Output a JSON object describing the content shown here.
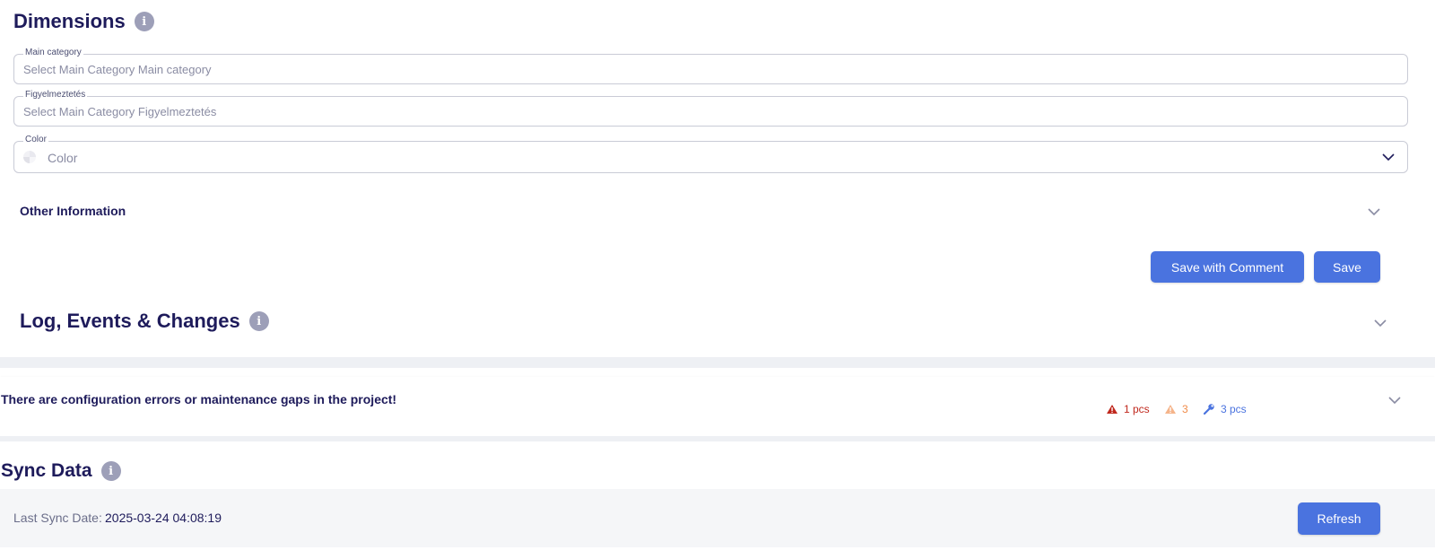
{
  "dimensions": {
    "title": "Dimensions",
    "info_icon": "i",
    "fields": [
      {
        "label": "Main category",
        "placeholder": "Select Main Category Main category"
      },
      {
        "label": "Figyelmeztetés",
        "placeholder": "Select Main Category Figyelmeztetés"
      },
      {
        "label": "Color",
        "placeholder": "Color"
      }
    ],
    "other_information": "Other Information",
    "buttons": {
      "save_with_comment": "Save with Comment",
      "save": "Save"
    }
  },
  "log": {
    "title": "Log, Events & Changes",
    "info_icon": "i"
  },
  "warnings": {
    "message": "There are configuration errors or maintenance gaps in the project!",
    "badges": [
      {
        "icon": "error-triangle-icon",
        "text": "1 pcs",
        "color": "#c0281d"
      },
      {
        "icon": "warning-triangle-icon",
        "text": "3",
        "color": "#f08c4a"
      },
      {
        "icon": "wrench-icon",
        "text": "3 pcs",
        "color": "#4a73df"
      }
    ]
  },
  "sync": {
    "title": "Sync Data",
    "info_icon": "i",
    "last_sync_label": "Last Sync Date:",
    "last_sync_value": "2025-03-24 04:08:19",
    "refresh_label": "Refresh"
  },
  "colors": {
    "primary": "#4a73df",
    "heading": "#1e1b5b",
    "border": "#c9cbd6",
    "band": "#eef0f4"
  }
}
